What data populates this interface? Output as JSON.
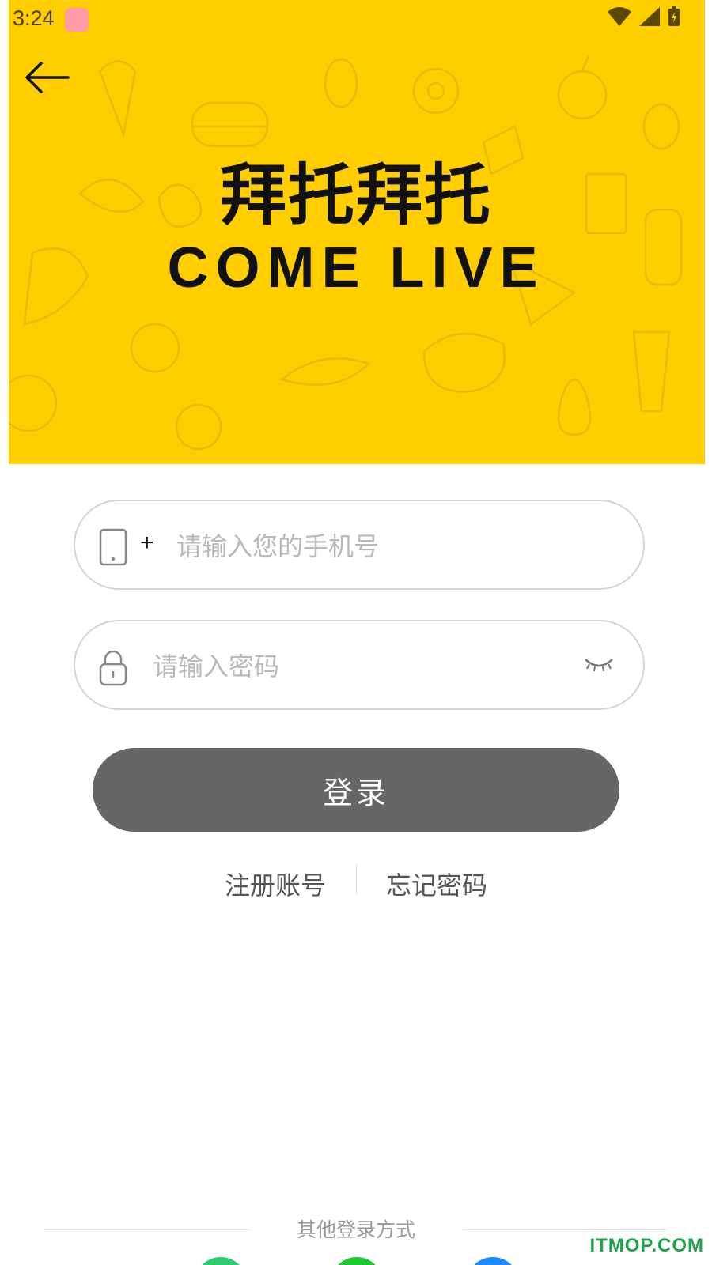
{
  "status_bar": {
    "time": "3:24"
  },
  "brand": {
    "title_cn": "拜托拜托",
    "title_en": "COME LIVE"
  },
  "colors": {
    "hero": "#FFCE00",
    "button": "#666666",
    "placeholder": "#B9B9B9"
  },
  "form": {
    "phone": {
      "prefix": "+",
      "placeholder": "请输入您的手机号",
      "value": ""
    },
    "password": {
      "placeholder": "请输入密码",
      "value": ""
    },
    "login_label": "登录"
  },
  "links": {
    "register": "注册账号",
    "forgot": "忘记密码"
  },
  "other_login": {
    "label": "其他登录方式",
    "methods": [
      "green-circle",
      "green-circle",
      "blue-circle"
    ]
  },
  "watermark": "ITMOP.COM",
  "icons": [
    "back-arrow-icon",
    "phone-icon",
    "lock-icon",
    "eye-closed-icon",
    "wifi-icon",
    "signal-icon",
    "battery-icon"
  ]
}
